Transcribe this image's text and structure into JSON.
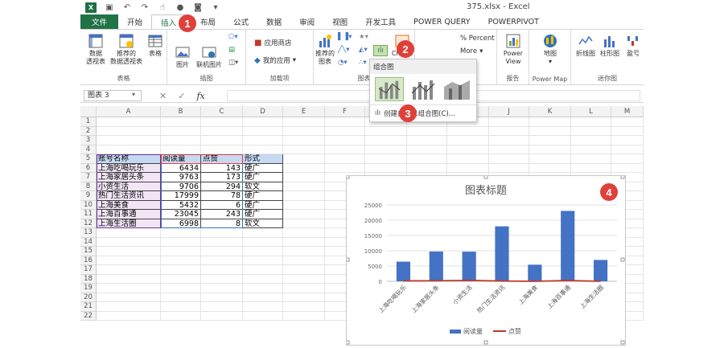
{
  "title": {
    "document": "375.xlsx - Excel"
  },
  "tabs": [
    {
      "label": "文件"
    },
    {
      "label": "开始"
    },
    {
      "label": "插入"
    },
    {
      "label": "页面布局",
      "visible": "布局"
    },
    {
      "label": "公式"
    },
    {
      "label": "数据"
    },
    {
      "label": "审阅"
    },
    {
      "label": "视图"
    },
    {
      "label": "开发工具"
    },
    {
      "label": "POWER QUERY"
    },
    {
      "label": "POWERPIVOT"
    }
  ],
  "ribbon": {
    "groups": {
      "tables": "表格",
      "illustrations": "插图",
      "addins": "加载项",
      "charts": "图表",
      "sparkline_group": "ll",
      "reports": "报告",
      "powermap": "Power Map",
      "sparklines": "迷你图"
    },
    "buttons": {
      "pivot": "数据\n透视表",
      "rec_pivot": "推荐的\n数据透视表",
      "table": "表格",
      "picture": "图片",
      "online_picture": "联机图片",
      "store": "应用商店",
      "my_apps": "我的应用",
      "rec_charts": "推荐的\n图表",
      "charts_btn": "Charts",
      "percent": "% Percent",
      "more": "More",
      "powerview": "Power\nView",
      "map": "地图",
      "line_spark": "折线图",
      "column_spark": "柱形图",
      "winloss_spark": "盈亏"
    }
  },
  "dropdown": {
    "header": "组合图",
    "custom": "创建自定义组合图(C)..."
  },
  "formula_bar": {
    "name_box": "图表 3",
    "fx": "fx",
    "formula": ""
  },
  "sheet": {
    "columns": [
      "A",
      "B",
      "C",
      "D",
      "E",
      "F",
      "G",
      "H",
      "I",
      "J",
      "K",
      "L",
      "M"
    ],
    "rows": [
      "1",
      "2",
      "3",
      "4",
      "5",
      "6",
      "7",
      "8",
      "9",
      "10",
      "11",
      "12",
      "13",
      "14",
      "15",
      "16",
      "17",
      "18",
      "19",
      "20",
      "21",
      "22"
    ],
    "headers": [
      "账号名称",
      "阅读量",
      "点赞",
      "形式"
    ],
    "data": [
      [
        "上海吃喝玩乐",
        "6434",
        "143",
        "硬广"
      ],
      [
        "上海家居头条",
        "9763",
        "173",
        "硬广"
      ],
      [
        "小资生活",
        "9706",
        "294",
        "软文"
      ],
      [
        "热门生活资讯",
        "17999",
        "78",
        "硬广"
      ],
      [
        "上海美食",
        "5432",
        "6",
        "硬广"
      ],
      [
        "上海百事通",
        "23045",
        "243",
        "硬广"
      ],
      [
        "上海生活圈",
        "6998",
        "8",
        "软文"
      ]
    ]
  },
  "badges": [
    "1",
    "2",
    "3",
    "4"
  ],
  "colors": {
    "excel_green": "#217346",
    "bar": "#4472c4",
    "line": "#c0392b",
    "badge": "#e0403a"
  },
  "chart_data": {
    "type": "bar",
    "title": "图表标题",
    "categories": [
      "上海吃喝玩乐",
      "上海家居头条",
      "小资生活",
      "热门生活资讯",
      "上海美食",
      "上海百事通",
      "上海生活圈"
    ],
    "series": [
      {
        "name": "阅读量",
        "type": "bar",
        "values": [
          6434,
          9763,
          9706,
          17999,
          5432,
          23045,
          6998
        ]
      },
      {
        "name": "点赞",
        "type": "line",
        "values": [
          143,
          173,
          294,
          78,
          6,
          243,
          8
        ]
      }
    ],
    "yticks": [
      "0",
      "5000",
      "10000",
      "15000",
      "20000",
      "25000"
    ],
    "ylim": [
      0,
      25000
    ],
    "legend": "bottom",
    "grid": true
  }
}
